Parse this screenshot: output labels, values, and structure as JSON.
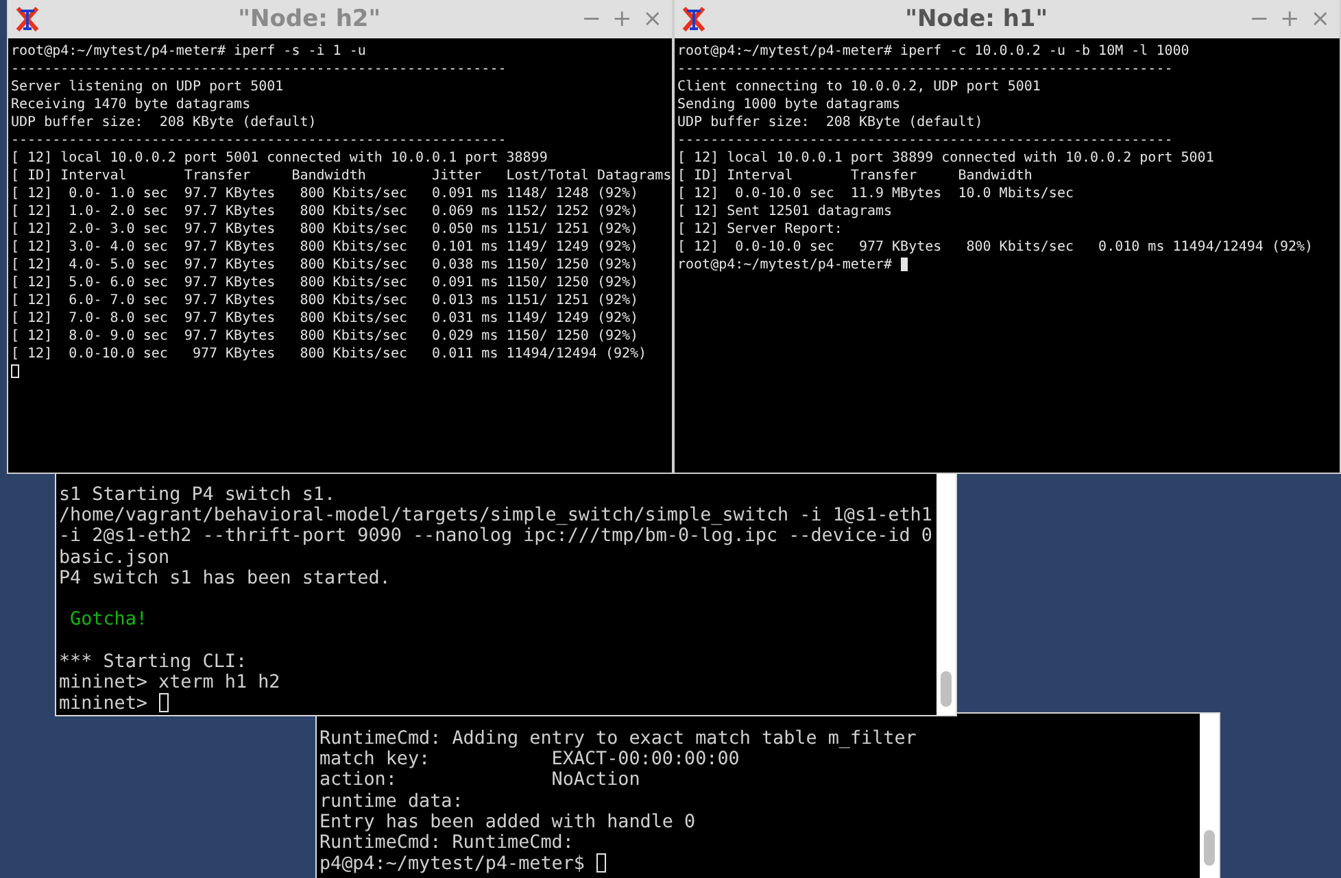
{
  "windows": [
    {
      "kind": "xterm",
      "title": "\"Node: h2\"",
      "focused": false,
      "controls": [
        "−",
        "+",
        "×"
      ],
      "cursor_on_new_line": true,
      "lines": [
        {
          "text": "root@p4:~/mytest/p4-meter# iperf -s -i 1 -u"
        },
        {
          "text": "------------------------------------------------------------"
        },
        {
          "text": "Server listening on UDP port 5001"
        },
        {
          "text": "Receiving 1470 byte datagrams"
        },
        {
          "text": "UDP buffer size:  208 KByte (default)"
        },
        {
          "text": "------------------------------------------------------------"
        },
        {
          "text": "[ 12] local 10.0.0.2 port 5001 connected with 10.0.0.1 port 38899"
        },
        {
          "text": "[ ID] Interval       Transfer     Bandwidth        Jitter   Lost/Total Datagrams"
        },
        {
          "text": "[ 12]  0.0- 1.0 sec  97.7 KBytes   800 Kbits/sec   0.091 ms 1148/ 1248 (92%)"
        },
        {
          "text": "[ 12]  1.0- 2.0 sec  97.7 KBytes   800 Kbits/sec   0.069 ms 1152/ 1252 (92%)"
        },
        {
          "text": "[ 12]  2.0- 3.0 sec  97.7 KBytes   800 Kbits/sec   0.050 ms 1151/ 1251 (92%)"
        },
        {
          "text": "[ 12]  3.0- 4.0 sec  97.7 KBytes   800 Kbits/sec   0.101 ms 1149/ 1249 (92%)"
        },
        {
          "text": "[ 12]  4.0- 5.0 sec  97.7 KBytes   800 Kbits/sec   0.038 ms 1150/ 1250 (92%)"
        },
        {
          "text": "[ 12]  5.0- 6.0 sec  97.7 KBytes   800 Kbits/sec   0.091 ms 1150/ 1250 (92%)"
        },
        {
          "text": "[ 12]  6.0- 7.0 sec  97.7 KBytes   800 Kbits/sec   0.013 ms 1151/ 1251 (92%)"
        },
        {
          "text": "[ 12]  7.0- 8.0 sec  97.7 KBytes   800 Kbits/sec   0.031 ms 1149/ 1249 (92%)"
        },
        {
          "text": "[ 12]  8.0- 9.0 sec  97.7 KBytes   800 Kbits/sec   0.029 ms 1150/ 1250 (92%)"
        },
        {
          "text": "[ 12]  0.0-10.0 sec   977 KBytes   800 Kbits/sec   0.011 ms 11494/12494 (92%)"
        }
      ]
    },
    {
      "kind": "xterm",
      "title": "\"Node: h1\"",
      "focused": true,
      "controls": [
        "−",
        "+",
        "×"
      ],
      "cursor_on_new_line": false,
      "lines": [
        {
          "text": "root@p4:~/mytest/p4-meter# iperf -c 10.0.0.2 -u -b 10M -l 1000"
        },
        {
          "text": "------------------------------------------------------------"
        },
        {
          "text": "Client connecting to 10.0.0.2, UDP port 5001"
        },
        {
          "text": "Sending 1000 byte datagrams"
        },
        {
          "text": "UDP buffer size:  208 KByte (default)"
        },
        {
          "text": "------------------------------------------------------------"
        },
        {
          "text": "[ 12] local 10.0.0.1 port 38899 connected with 10.0.0.2 port 5001"
        },
        {
          "text": "[ ID] Interval       Transfer     Bandwidth"
        },
        {
          "text": "[ 12]  0.0-10.0 sec  11.9 MBytes  10.0 Mbits/sec"
        },
        {
          "text": "[ 12] Sent 12501 datagrams"
        },
        {
          "text": "[ 12] Server Report:"
        },
        {
          "text": "[ 12]  0.0-10.0 sec   977 KBytes   800 Kbits/sec   0.010 ms 11494/12494 (92%)"
        },
        {
          "text": "root@p4:~/mytest/p4-meter# "
        }
      ]
    },
    {
      "kind": "terminal",
      "focused": false,
      "cursor_on_new_line": false,
      "lines": [
        {
          "text": "s1 Starting P4 switch s1."
        },
        {
          "text": "/home/vagrant/behavioral-model/targets/simple_switch/simple_switch -i 1@s1-eth1"
        },
        {
          "text": "-i 2@s1-eth2 --thrift-port 9090 --nanolog ipc:///tmp/bm-0-log.ipc --device-id 0"
        },
        {
          "text": "basic.json"
        },
        {
          "text": "P4 switch s1 has been started."
        },
        {
          "text": " Gotcha!",
          "blank_before": true,
          "color": "#17b417"
        },
        {
          "text": "*** Starting CLI:",
          "blank_before": true
        },
        {
          "text": "mininet> xterm h1 h2"
        },
        {
          "text": "mininet> "
        }
      ]
    },
    {
      "kind": "terminal",
      "focused": false,
      "cursor_on_new_line": false,
      "lines": [
        {
          "text": "RuntimeCmd: Adding entry to exact match table m_filter"
        },
        {
          "text": "match key:           EXACT-00:00:00:00"
        },
        {
          "text": "action:              NoAction"
        },
        {
          "text": "runtime data:"
        },
        {
          "text": "Entry has been added with handle 0"
        },
        {
          "text": "RuntimeCmd: RuntimeCmd:"
        },
        {
          "text": "p4@p4:~/mytest/p4-meter$ "
        }
      ]
    }
  ]
}
